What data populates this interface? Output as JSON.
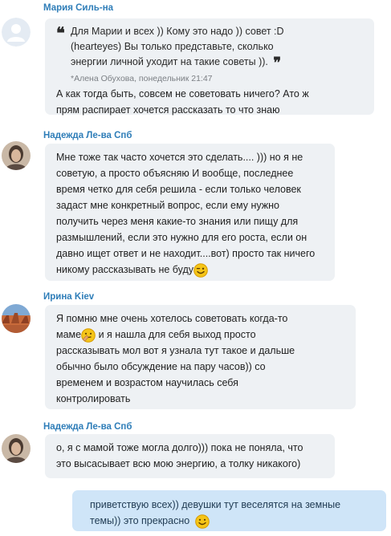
{
  "messages": [
    {
      "sender": "Мария Силь-на",
      "avatar": "default-avatar-icon",
      "quote": {
        "lines": [
          "Для Марии и всех ))  Кому это надо )) совет :D",
          "(heartеyes)    Вы только представьте, сколько",
          "энергии личной уходит на такие советы ))."
        ],
        "meta": "*Алена Обухова, понедельник 21:47"
      },
      "lines": [
        "А как тогда быть, совсем не советовать ничего? Ато ж",
        "прям распирает хочется рассказать то что знаю"
      ]
    },
    {
      "sender": "Надежда Ле-ва Спб",
      "avatar": "user-photo-icon",
      "lines": [
        "Мне тоже так часто хочется это сделать.... ))) но я не",
        "советую, а просто объясняю И вообще, последнее",
        "время четко для себя решила - если только человек",
        "задаст мне конкретный вопрос, если ему нужно",
        "получить через меня какие-то знания или пищу для",
        "размышлений, если это нужно для его роста, если он",
        "давно ищет ответ и не находит....вот) просто так ничего",
        "никому рассказывать не буду"
      ]
    },
    {
      "sender": "Ирина Kiev",
      "avatar": "landscape-photo-icon",
      "lines": [
        "Я помню мне очень хотелось советовать когда-то",
        "маме",
        " и я нашла для себя выход просто",
        "рассказывать мол вот я узнала тут такое и дальше",
        "обычно было обсуждение на пару часов)) со",
        "временем и возрастом научилась себя",
        "контролировать"
      ]
    },
    {
      "sender": "Надежда Ле-ва Спб",
      "avatar": "user-photo-icon",
      "lines": [
        "о, я с мамой тоже могла долго))) пока не поняла, что",
        "это высасывает всю мою энергию, а толку никакого)"
      ]
    }
  ],
  "own_message": {
    "lines": [
      "приветствую всех)) девушки тут веселятся на земные",
      "темы)) это прекрасно"
    ]
  },
  "colors": {
    "sender": "#2e7db8",
    "incoming_bubble": "#eef1f4",
    "outgoing_bubble": "#cfe5f8",
    "emoticon": "#f5c518"
  }
}
